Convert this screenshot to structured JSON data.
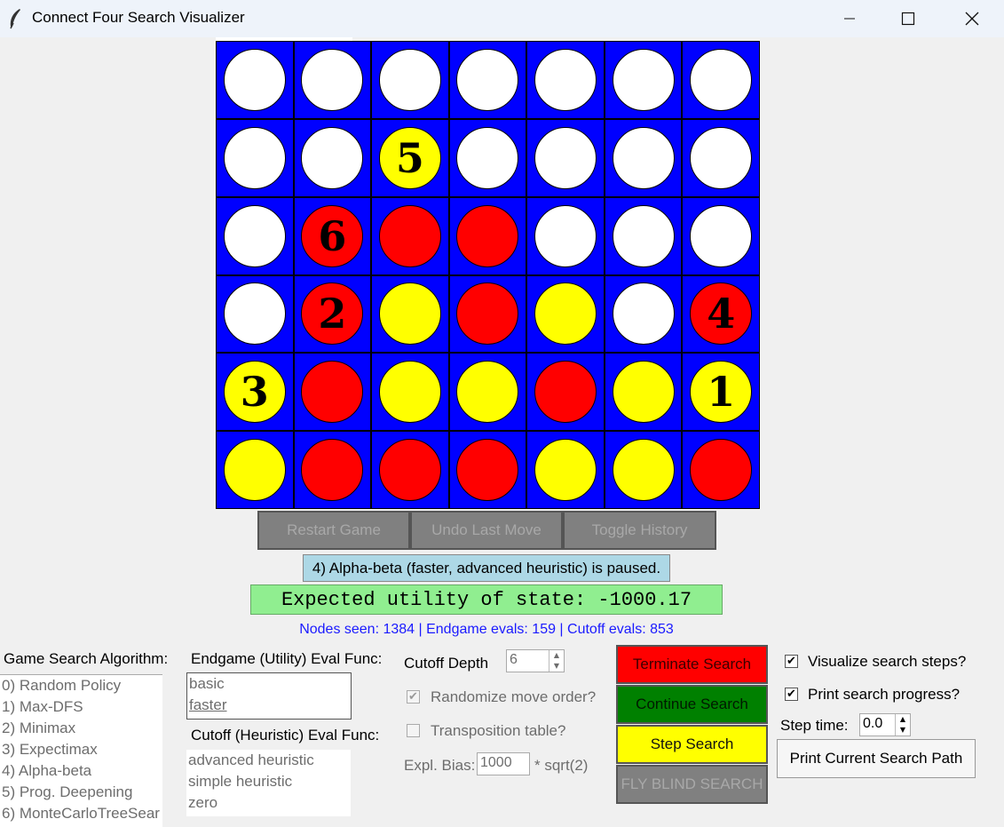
{
  "window": {
    "title": "Connect Four Search Visualizer"
  },
  "icons": {
    "app": "feather-icon",
    "minimize": "minimize-icon",
    "maximize": "maximize-icon",
    "close": "close-icon"
  },
  "colors": {
    "board": "#0000ff",
    "red": "#ff0000",
    "yellow": "#ffff00",
    "empty": "#ffffff"
  },
  "board": [
    [
      {
        "c": "W",
        "n": ""
      },
      {
        "c": "W",
        "n": ""
      },
      {
        "c": "W",
        "n": ""
      },
      {
        "c": "W",
        "n": ""
      },
      {
        "c": "W",
        "n": ""
      },
      {
        "c": "W",
        "n": ""
      },
      {
        "c": "W",
        "n": ""
      }
    ],
    [
      {
        "c": "W",
        "n": ""
      },
      {
        "c": "W",
        "n": ""
      },
      {
        "c": "Y",
        "n": "5"
      },
      {
        "c": "W",
        "n": ""
      },
      {
        "c": "W",
        "n": ""
      },
      {
        "c": "W",
        "n": ""
      },
      {
        "c": "W",
        "n": ""
      }
    ],
    [
      {
        "c": "W",
        "n": ""
      },
      {
        "c": "R",
        "n": "6"
      },
      {
        "c": "R",
        "n": ""
      },
      {
        "c": "R",
        "n": ""
      },
      {
        "c": "W",
        "n": ""
      },
      {
        "c": "W",
        "n": ""
      },
      {
        "c": "W",
        "n": ""
      }
    ],
    [
      {
        "c": "W",
        "n": ""
      },
      {
        "c": "R",
        "n": "2"
      },
      {
        "c": "Y",
        "n": ""
      },
      {
        "c": "R",
        "n": ""
      },
      {
        "c": "Y",
        "n": ""
      },
      {
        "c": "W",
        "n": ""
      },
      {
        "c": "R",
        "n": "4"
      }
    ],
    [
      {
        "c": "Y",
        "n": "3"
      },
      {
        "c": "R",
        "n": ""
      },
      {
        "c": "Y",
        "n": ""
      },
      {
        "c": "Y",
        "n": ""
      },
      {
        "c": "R",
        "n": ""
      },
      {
        "c": "Y",
        "n": ""
      },
      {
        "c": "Y",
        "n": "1"
      }
    ],
    [
      {
        "c": "Y",
        "n": ""
      },
      {
        "c": "R",
        "n": ""
      },
      {
        "c": "R",
        "n": ""
      },
      {
        "c": "R",
        "n": ""
      },
      {
        "c": "Y",
        "n": ""
      },
      {
        "c": "Y",
        "n": ""
      },
      {
        "c": "R",
        "n": ""
      }
    ]
  ],
  "game_buttons": {
    "restart": "Restart Game",
    "undo": "Undo Last Move",
    "history": "Toggle History"
  },
  "status": "4) Alpha-beta (faster, advanced heuristic) is paused.",
  "utility": "Expected utility of state: -1000.17",
  "stats": "Nodes seen: 1384 | Endgame evals: 159 | Cutoff evals: 853",
  "algorithm": {
    "label": "Game Search Algorithm:",
    "items": [
      "0) Random Policy",
      "1) Max-DFS",
      "2) Minimax",
      "3) Expectimax",
      "4) Alpha-beta",
      "5) Prog. Deepening",
      "6) MonteCarloTreeSear"
    ]
  },
  "endgame": {
    "label": "Endgame (Utility) Eval Func:",
    "items": [
      "basic",
      "faster"
    ]
  },
  "cutoff_func": {
    "label": "Cutoff (Heuristic) Eval Func:",
    "items": [
      "advanced heuristic",
      "simple heuristic",
      "zero"
    ]
  },
  "cutoff_depth": {
    "label": "Cutoff Depth",
    "value": "6"
  },
  "randomize": {
    "label": "Randomize move order?",
    "checked": true
  },
  "transposition": {
    "label": "Transposition table?",
    "checked": false
  },
  "expl_bias": {
    "label": "Expl. Bias:",
    "value": "1000",
    "suffix": "* sqrt(2)"
  },
  "controls": {
    "terminate": "Terminate Search",
    "continue": "Continue Search",
    "step": "Step Search",
    "fly_blind": "FLY BLIND SEARCH"
  },
  "options": {
    "visualize": {
      "label": "Visualize search steps?",
      "checked": true
    },
    "print_progress": {
      "label": "Print search progress?",
      "checked": true
    },
    "step_time": {
      "label": "Step time:",
      "value": "0.0"
    },
    "print_path": "Print Current Search Path"
  }
}
